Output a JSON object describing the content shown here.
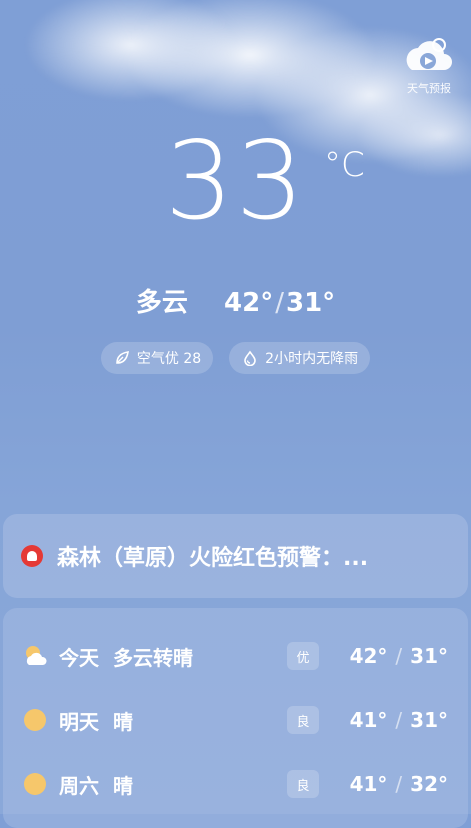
{
  "brand": {
    "label": "天气预报"
  },
  "current": {
    "temp": "33",
    "unit": "°C",
    "condition": "多云",
    "high": "42°",
    "low": "31°"
  },
  "chips": [
    {
      "icon": "leaf-icon",
      "label": "空气优 28"
    },
    {
      "icon": "raindrop-icon",
      "label": "2小时内无降雨"
    }
  ],
  "alert": {
    "icon": "alarm-icon",
    "text": "森林（草原）火险红色预警：..."
  },
  "forecast": [
    {
      "day": "今天",
      "condition": "多云转晴",
      "aqi": "优",
      "high": "42°",
      "low": "31°",
      "icon": "partly-cloudy-icon"
    },
    {
      "day": "明天",
      "condition": "晴",
      "aqi": "良",
      "high": "41°",
      "low": "31°",
      "icon": "sun-icon"
    },
    {
      "day": "周六",
      "condition": "晴",
      "aqi": "良",
      "high": "41°",
      "low": "32°",
      "icon": "sun-icon"
    }
  ],
  "colors": {
    "alert_red": "#e53935",
    "sun_yellow": "#f6c76b"
  }
}
